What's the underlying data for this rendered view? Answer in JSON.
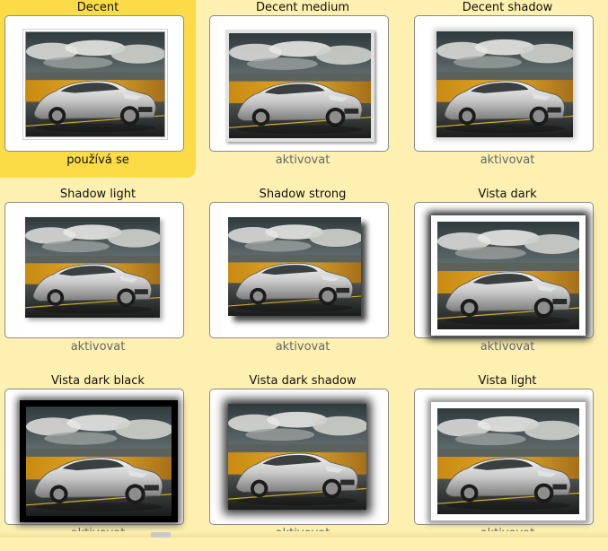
{
  "styles": [
    {
      "title": "Decent",
      "status": "používá se",
      "variant": "decent",
      "active": true
    },
    {
      "title": "Decent medium",
      "status": "aktivovat",
      "variant": "decent-medium",
      "active": false
    },
    {
      "title": "Decent shadow",
      "status": "aktivovat",
      "variant": "decent-shadow",
      "active": false
    },
    {
      "title": "Shadow light",
      "status": "aktivovat",
      "variant": "shadow-light",
      "active": false
    },
    {
      "title": "Shadow strong",
      "status": "aktivovat",
      "variant": "shadow-strong",
      "active": false
    },
    {
      "title": "Vista dark",
      "status": "aktivovat",
      "variant": "vista-dark",
      "active": false
    },
    {
      "title": "Vista dark black",
      "status": "aktivovat",
      "variant": "vista-dark-black",
      "active": false
    },
    {
      "title": "Vista dark shadow",
      "status": "aktivovat",
      "variant": "vista-dark-shadow",
      "active": false
    },
    {
      "title": "Vista light",
      "status": "aktivovat",
      "variant": "vista-light",
      "active": false
    }
  ],
  "colors": {
    "page_background": "#fdf0b0",
    "active_highlight": "#fbdc47",
    "frame_border": "#8a8a8a",
    "link_text": "#666666"
  }
}
